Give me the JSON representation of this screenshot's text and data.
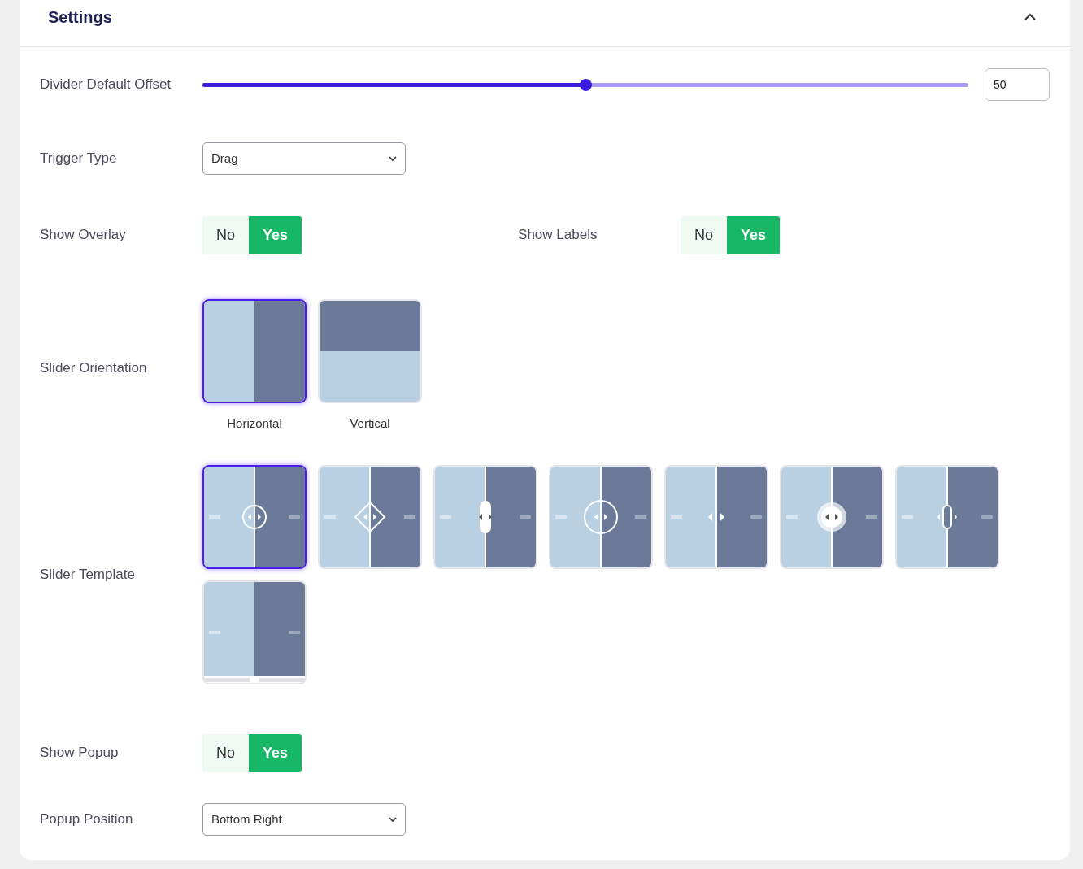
{
  "panel": {
    "title": "Settings",
    "expanded": true
  },
  "offset": {
    "label": "Divider Default Offset",
    "level": 0.5,
    "value": "50"
  },
  "trigger_type": {
    "label": "Trigger Type",
    "value": "Drag"
  },
  "show_overlay": {
    "label": "Show Overlay",
    "options": [
      {
        "label": "No",
        "selected": false
      },
      {
        "label": "Yes",
        "selected": true
      }
    ]
  },
  "show_labels": {
    "label": "Show Labels",
    "options": [
      {
        "label": "No",
        "selected": false
      },
      {
        "label": "Yes",
        "selected": true
      }
    ]
  },
  "slider_orientation": {
    "label": "Slider Orientation",
    "options": [
      {
        "kind": "horizontal",
        "label": "Horizontal",
        "selected": true
      },
      {
        "kind": "vertical",
        "label": "Vertical",
        "selected": false
      }
    ]
  },
  "slider_template": {
    "label": "Slider Template",
    "options": [
      {
        "kind": "circle",
        "selected": true
      },
      {
        "kind": "diamond",
        "selected": false
      },
      {
        "kind": "pill",
        "selected": false
      },
      {
        "kind": "ring",
        "selected": false
      },
      {
        "kind": "arrows",
        "selected": false
      },
      {
        "kind": "disc",
        "selected": false
      },
      {
        "kind": "capsule",
        "selected": false
      },
      {
        "kind": "scrollbar",
        "selected": false
      }
    ]
  },
  "show_popup": {
    "label": "Show Popup",
    "options": [
      {
        "label": "No",
        "selected": false
      },
      {
        "label": "Yes",
        "selected": true
      }
    ]
  },
  "popup_position": {
    "label": "Popup Position",
    "value": "Bottom Right"
  }
}
